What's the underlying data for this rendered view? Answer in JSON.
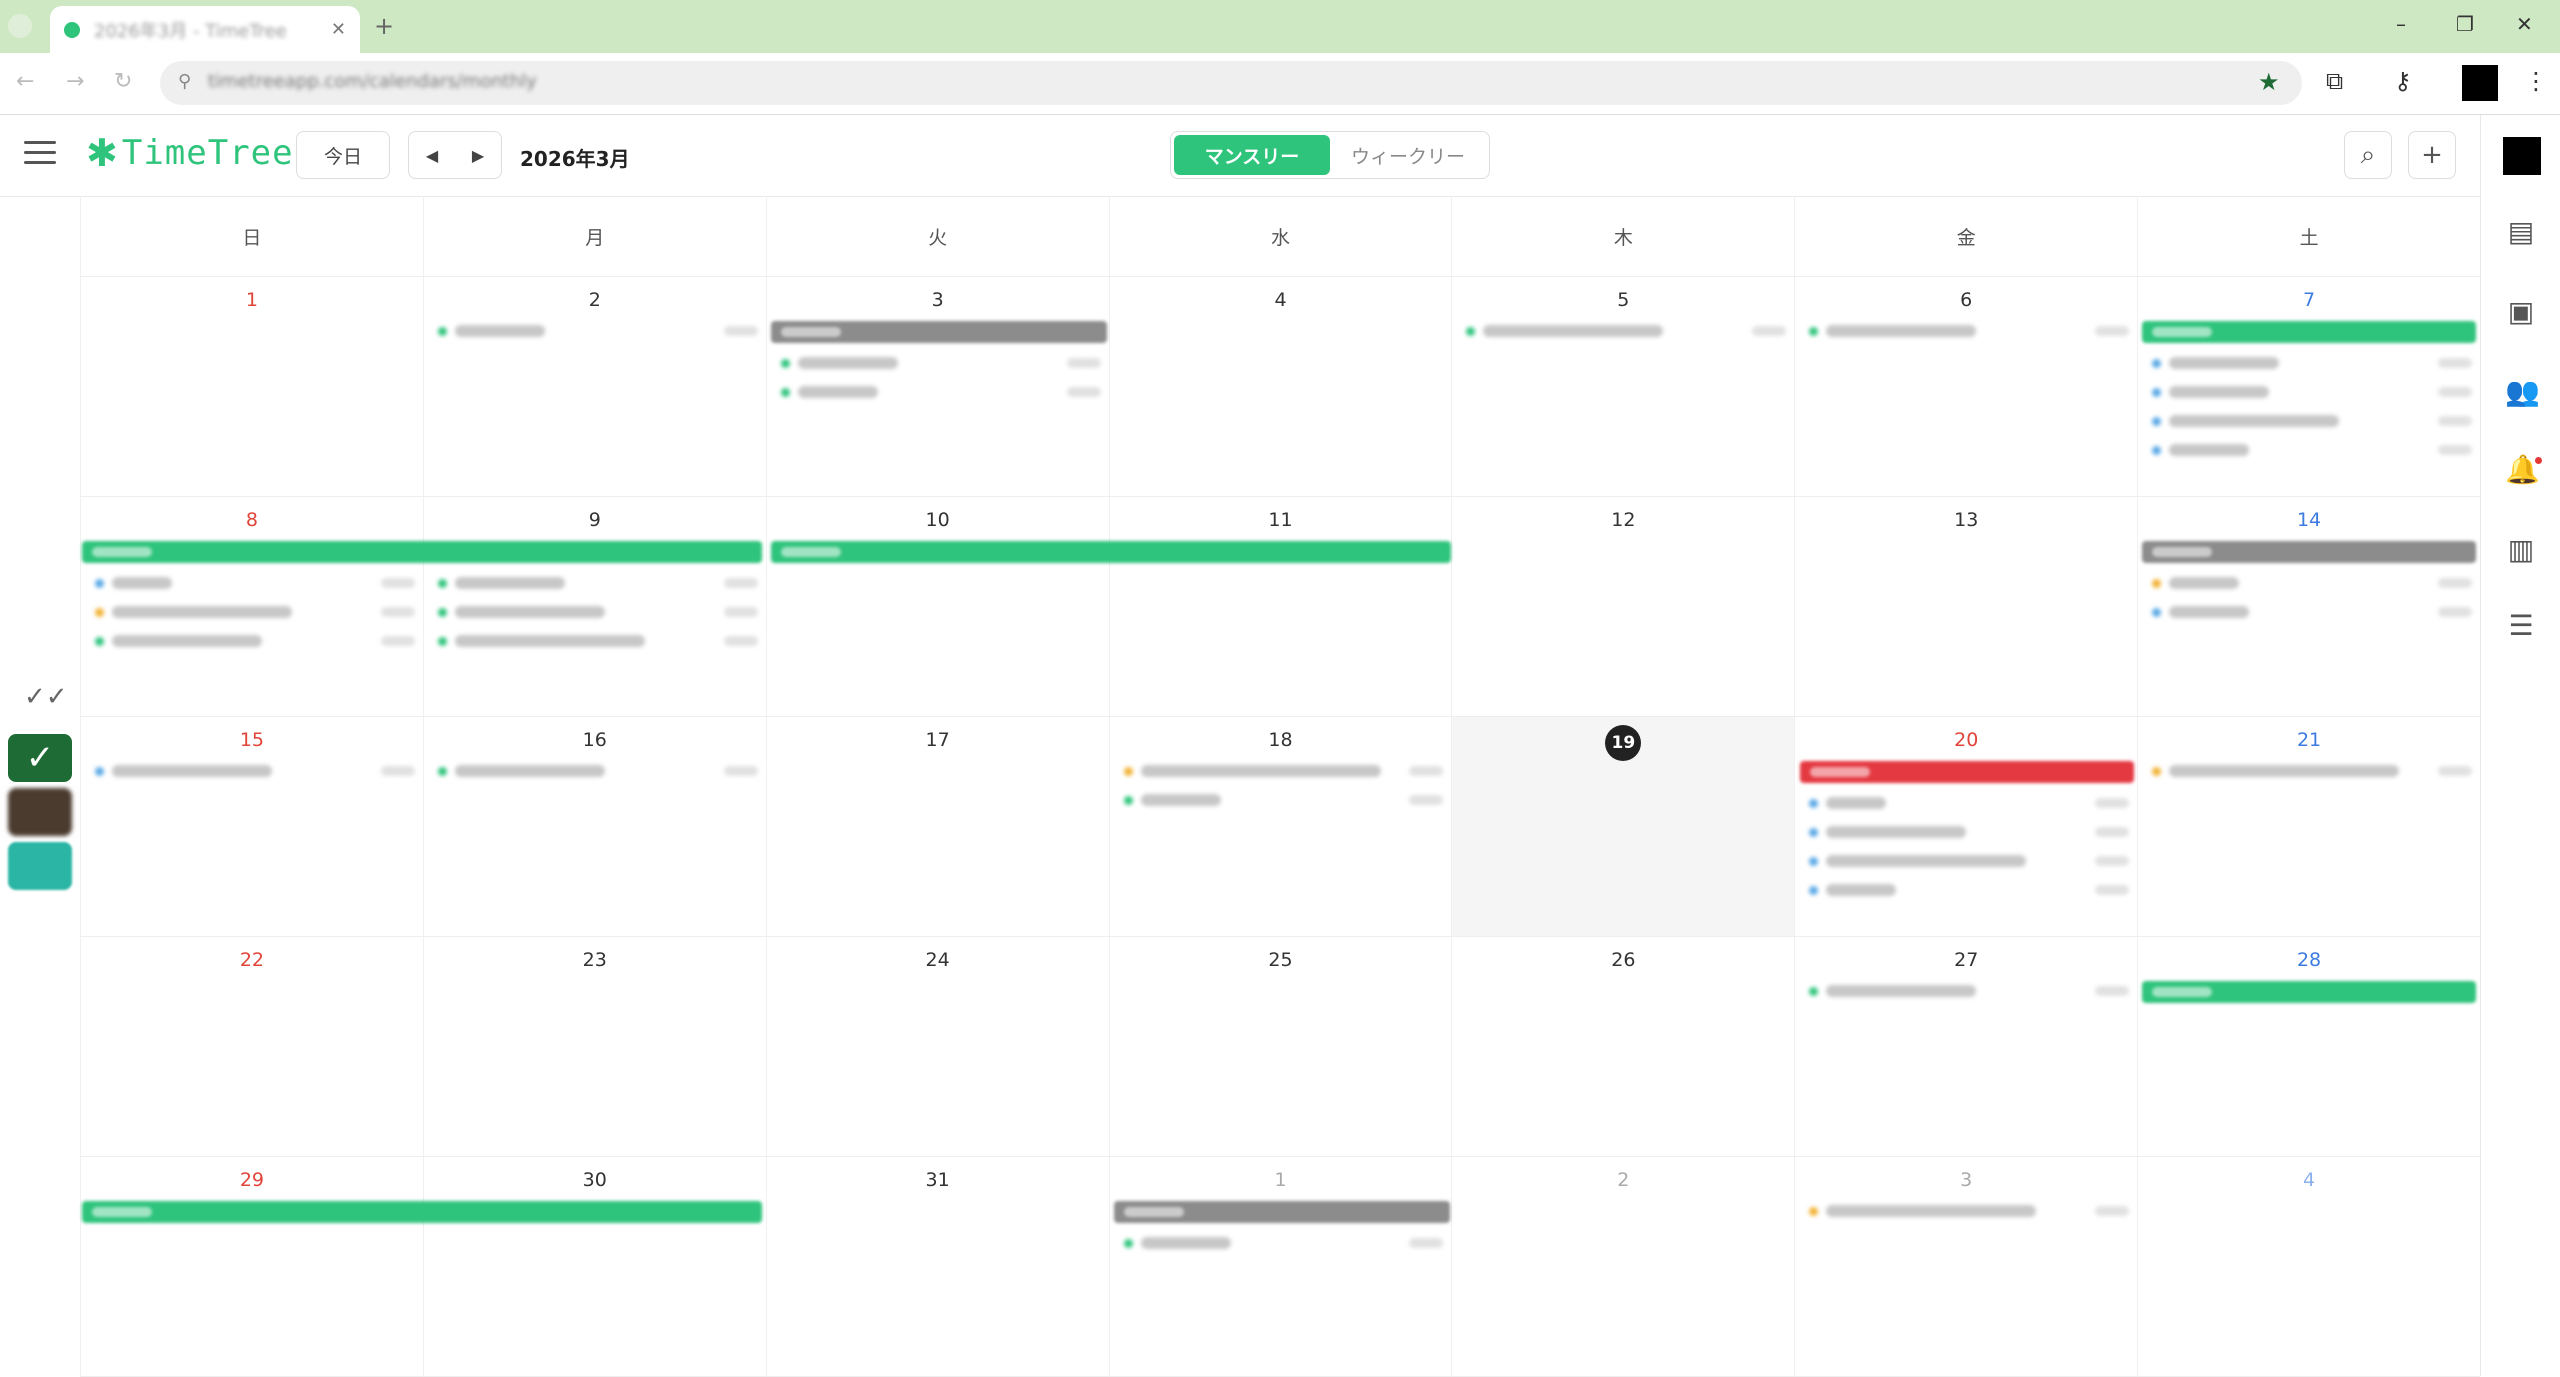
{
  "browser": {
    "tab_title": "2026年3月 - TimeTree",
    "url": "timetreeapp.com/calendars/monthly",
    "window": {
      "minimize": "–",
      "restore": "❐",
      "close": "✕"
    }
  },
  "header": {
    "logo_text": "TimeTree",
    "today_label": "今日",
    "prev_arrow": "◀",
    "next_arrow": "▶",
    "month_label": "2026年3月",
    "views": {
      "monthly": "マンスリー",
      "weekly": "ウィークリー"
    },
    "search_icon": "search-icon",
    "add_icon": "plus-icon"
  },
  "weekday_names": [
    "日",
    "月",
    "火",
    "水",
    "木",
    "金",
    "土"
  ],
  "weeks": [
    [
      "1",
      "2",
      "3",
      "4",
      "5",
      "6",
      "7"
    ],
    [
      "8",
      "9",
      "10",
      "11",
      "12",
      "13",
      "14"
    ],
    [
      "15",
      "16",
      "17",
      "18",
      "19",
      "20",
      "21"
    ],
    [
      "22",
      "23",
      "24",
      "25",
      "26",
      "27",
      "28"
    ],
    [
      "29",
      "30",
      "31",
      "1",
      "2",
      "3",
      "4"
    ]
  ],
  "today": "19",
  "colors": {
    "brand_green": "#2fc47c",
    "sunday_red": "#e0453a",
    "saturday_blue": "#3d7be0",
    "event_red": "#e53942",
    "event_gray": "#8c8c8c"
  },
  "left_rail": {
    "check_all_icon": "double-check-icon"
  },
  "right_rail": {
    "icons": [
      "memo-icon",
      "album-icon",
      "members-icon",
      "bell-icon",
      "news-icon",
      "settings-sliders-icon"
    ]
  }
}
